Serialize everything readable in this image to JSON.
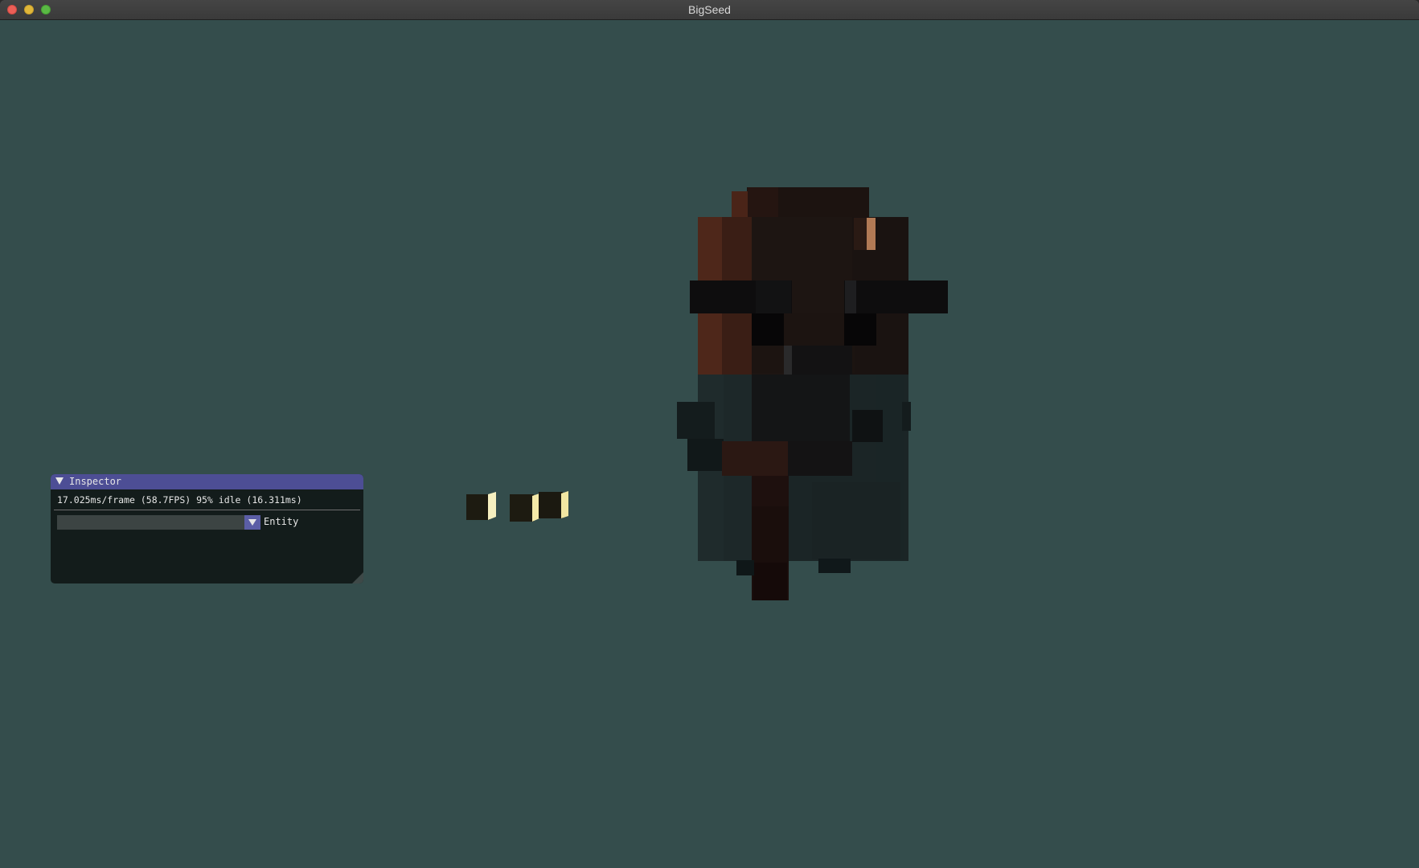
{
  "window": {
    "title": "BigSeed"
  },
  "colors": {
    "viewport_background": "#344d4c",
    "inspector_header": "#4d4e95",
    "combo_button": "#5b5ea6"
  },
  "inspector": {
    "title": "Inspector",
    "stats": "17.025ms/frame (58.7FPS) 95% idle (16.311ms)",
    "combo_value": "",
    "combo_label": "Entity"
  }
}
